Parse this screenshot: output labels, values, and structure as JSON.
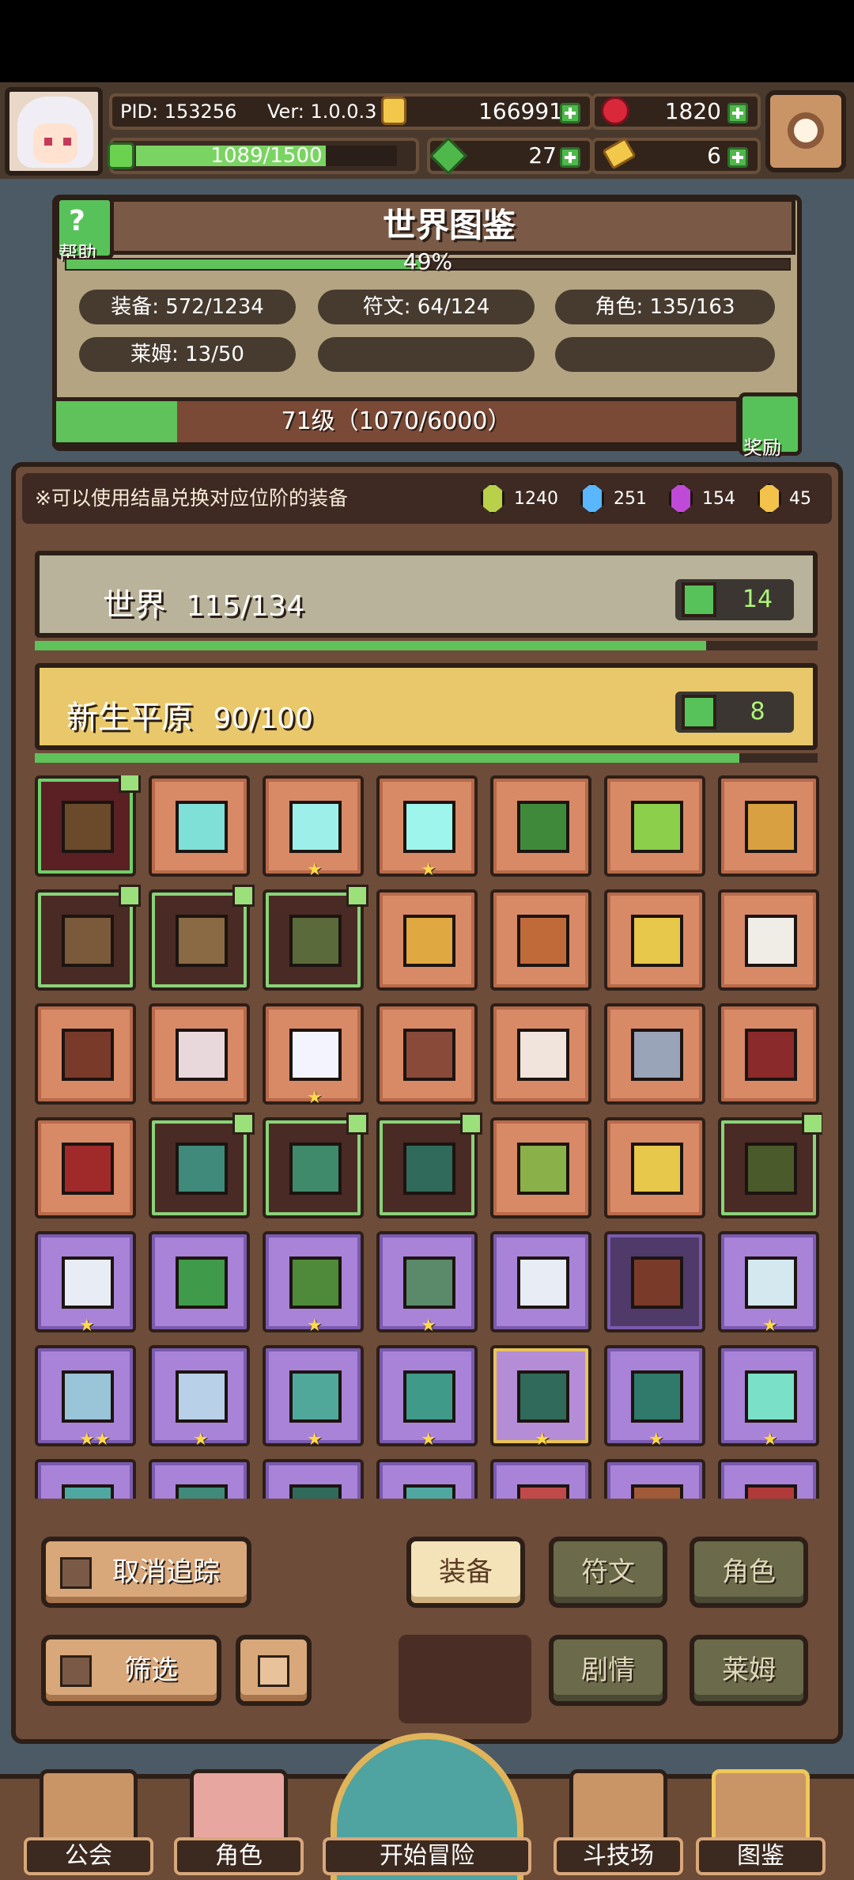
{
  "top": {
    "pid": "PID: 153256",
    "version": "Ver: 1.0.0.3",
    "gold": "166991",
    "ruby": "1820",
    "xp": "1089/1500",
    "xp_fraction": 0.726,
    "green_token": "27",
    "key": "6"
  },
  "album": {
    "title": "世界图鉴",
    "help": "帮助",
    "percent": "49%",
    "percent_value": 0.49,
    "stats": {
      "equip": "装备: 572/1234",
      "rune": "符文: 64/124",
      "role": "角色: 135/163",
      "slime": "莱姆: 13/50"
    },
    "level": "71级（1070/6000）",
    "level_fraction": 0.178,
    "reward": "奖励"
  },
  "crystals": {
    "note": "※可以使用结晶兑换对应位阶的装备",
    "items": [
      {
        "color": "#b9d04a",
        "count": "1240"
      },
      {
        "color": "#5ab6ff",
        "count": "251"
      },
      {
        "color": "#c04ad8",
        "count": "154"
      },
      {
        "color": "#f2c24a",
        "count": "45"
      }
    ]
  },
  "regions": [
    {
      "name": "世界",
      "progress": "115/134",
      "likes": "14",
      "fraction": 0.858
    },
    {
      "name": "新生平原",
      "progress": "90/100",
      "likes": "8",
      "fraction": 0.9
    }
  ],
  "grid": {
    "rows": [
      [
        {
          "s": "darkred",
          "c": "#6a4a2a",
          "f": 1
        },
        {
          "s": "orange",
          "c": "#7fe0d8"
        },
        {
          "s": "orange",
          "c": "#9df0ea",
          "st": "★"
        },
        {
          "s": "orange",
          "c": "#9ef5ec",
          "st": "★"
        },
        {
          "s": "orange",
          "c": "#3f8a3a"
        },
        {
          "s": "orange",
          "c": "#8ccf4a"
        },
        {
          "s": "orange",
          "c": "#d8a040"
        }
      ],
      [
        {
          "s": "dark",
          "c": "#7a5a3a",
          "f": 1
        },
        {
          "s": "dark",
          "c": "#8a6a44",
          "f": 1
        },
        {
          "s": "dark",
          "c": "#5a6a3a",
          "f": 1
        },
        {
          "s": "orange",
          "c": "#e0a840"
        },
        {
          "s": "orange",
          "c": "#c06a3a"
        },
        {
          "s": "orange",
          "c": "#e8c84a"
        },
        {
          "s": "orange",
          "c": "#f0ece6"
        }
      ],
      [
        {
          "s": "orange",
          "c": "#7a3a2a"
        },
        {
          "s": "orange",
          "c": "#e8d8dc"
        },
        {
          "s": "orange",
          "c": "#f4f4ff",
          "st": "★"
        },
        {
          "s": "orange",
          "c": "#8a4a3a"
        },
        {
          "s": "orange",
          "c": "#f0e4dc"
        },
        {
          "s": "orange",
          "c": "#9aa4b8"
        },
        {
          "s": "orange",
          "c": "#8a2a2a"
        }
      ],
      [
        {
          "s": "orange",
          "c": "#a02a2a"
        },
        {
          "s": "dark",
          "c": "#3f8a7a",
          "f": 1
        },
        {
          "s": "dark",
          "c": "#3f8a6a",
          "f": 1
        },
        {
          "s": "dark",
          "c": "#2f6a5a",
          "f": 1
        },
        {
          "s": "orange",
          "c": "#8ab04a"
        },
        {
          "s": "orange",
          "c": "#e8c84a"
        },
        {
          "s": "dark",
          "c": "#4a5a2a",
          "f": 1
        }
      ],
      [
        {
          "s": "purple",
          "c": "#e8ecf4",
          "st": "★"
        },
        {
          "s": "purple",
          "c": "#3f9a4a"
        },
        {
          "s": "purple",
          "c": "#4f8a3a",
          "st": "★"
        },
        {
          "s": "purple",
          "c": "#5a8a6a",
          "st": "★"
        },
        {
          "s": "purple",
          "c": "#e8ecf4"
        },
        {
          "s": "purple-dark",
          "c": "#7a3a2a"
        },
        {
          "s": "purple",
          "c": "#d4e8f0",
          "st": "★"
        }
      ],
      [
        {
          "s": "purple",
          "c": "#9ac4d8",
          "st": "★★"
        },
        {
          "s": "purple",
          "c": "#b8d0e8",
          "st": "★"
        },
        {
          "s": "purple",
          "c": "#4fa89a",
          "st": "★"
        },
        {
          "s": "purple",
          "c": "#3f9a8a",
          "st": "★"
        },
        {
          "s": "purple-gold",
          "c": "#2f6a5a",
          "st": "★"
        },
        {
          "s": "purple",
          "c": "#2f7a6a",
          "st": "★"
        },
        {
          "s": "purple",
          "c": "#7ae0c8",
          "st": "★"
        }
      ],
      [
        {
          "s": "purple",
          "c": "#4fa8a0"
        },
        {
          "s": "purple",
          "c": "#3f8a7a"
        },
        {
          "s": "purple",
          "c": "#2f6a5a"
        },
        {
          "s": "purple",
          "c": "#4fa8a0"
        },
        {
          "s": "purple",
          "c": "#c04a4a"
        },
        {
          "s": "purple",
          "c": "#a05a3a"
        },
        {
          "s": "purple",
          "c": "#b03a3a"
        }
      ]
    ]
  },
  "controls": {
    "untrack": "取消追踪",
    "filter": "筛选",
    "equip": "装备",
    "rune": "符文",
    "role": "角色",
    "story": "剧情",
    "slime": "莱姆"
  },
  "nav": {
    "guild": "公会",
    "role": "角色",
    "adventure": "开始冒险",
    "arena": "斗技场",
    "album": "图鉴"
  }
}
